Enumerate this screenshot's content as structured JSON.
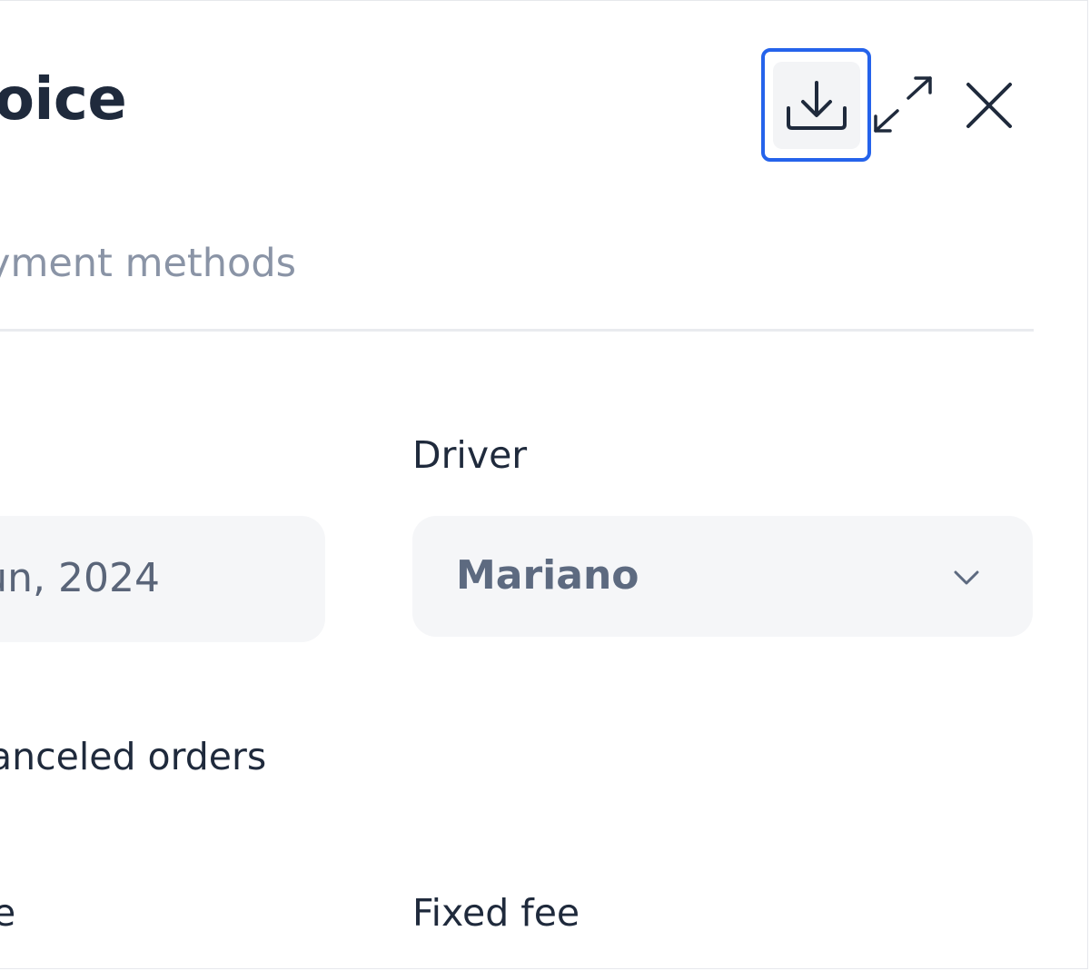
{
  "header": {
    "title": "oice",
    "download_icon": "download-icon",
    "expand_icon": "expand-icon",
    "close_icon": "close-icon",
    "accent_color": "#2563eb"
  },
  "tabs": {
    "active_label": "yment methods"
  },
  "form": {
    "date_value": "un, 2024",
    "driver_label": "Driver",
    "driver_value": "Mariano",
    "canceled_orders_label": "anceled orders",
    "partial_left_label": "e",
    "fixed_fee_label": "Fixed fee"
  }
}
